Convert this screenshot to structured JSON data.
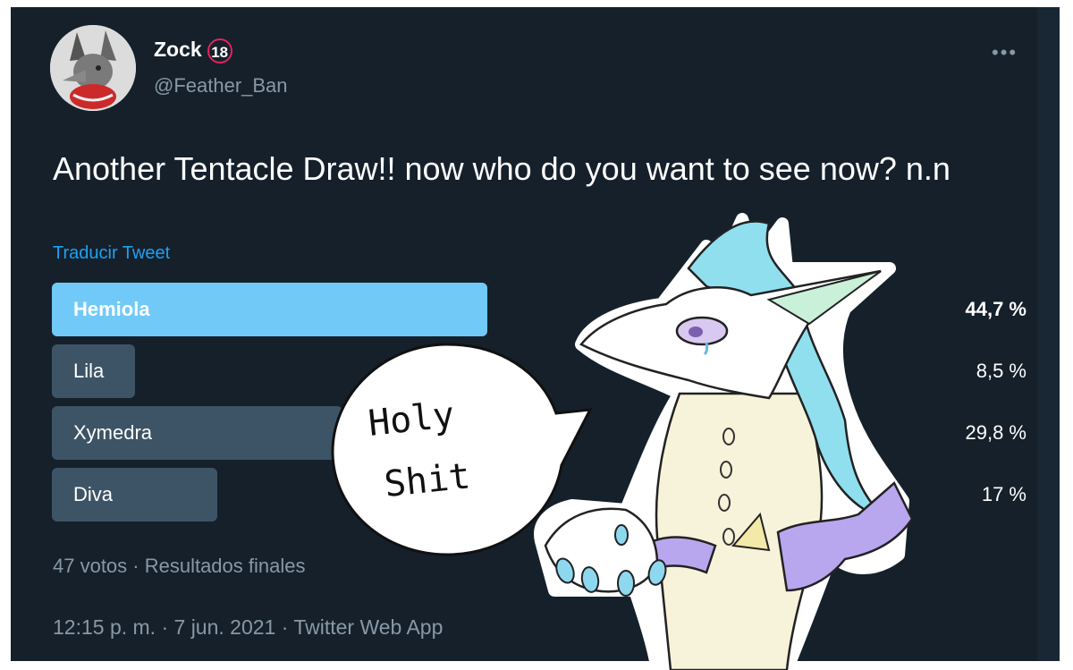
{
  "tweet": {
    "author_name": "Zock",
    "author_badge": "18",
    "author_handle": "@Feather_Ban",
    "more_icon": "more-icon",
    "text": "Another Tentacle Draw!! now who do you want to see now? n.n",
    "translate_label": "Traducir Tweet",
    "poll": {
      "options": [
        {
          "label": "Hemiola",
          "percent": "44,7 %",
          "value": 44.7,
          "winner": true
        },
        {
          "label": "Lila",
          "percent": "8,5 %",
          "value": 8.5,
          "winner": false
        },
        {
          "label": "Xymedra",
          "percent": "29,8 %",
          "value": 29.8,
          "winner": false
        },
        {
          "label": "Diva",
          "percent": "17 %",
          "value": 17,
          "winner": false
        }
      ],
      "summary": "47 votos · Resultados finales"
    },
    "timestamp": "12:15 p. m. · 7 jun. 2021 · Twitter Web App"
  },
  "overlay": {
    "speech_line1": "Holy",
    "speech_line2": "Shit"
  },
  "colors": {
    "background": "#15202b",
    "winner_bar": "#71c9f8",
    "bar": "#3d5466",
    "link": "#1da1f2",
    "muted": "#8899a6",
    "badge_ring": "#e0245e"
  }
}
